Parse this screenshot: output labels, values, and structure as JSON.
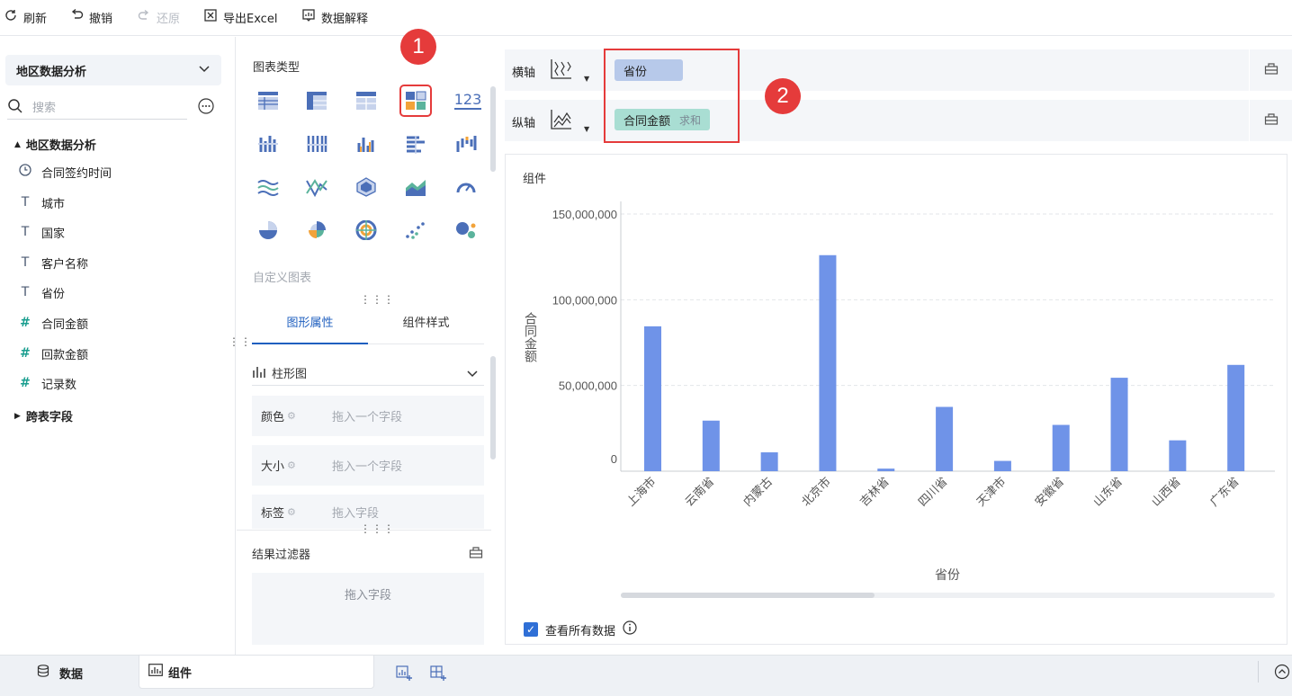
{
  "toolbar": {
    "refresh": "刷新",
    "undo": "撤销",
    "redo": "还原",
    "export": "导出Excel",
    "explain": "数据解释"
  },
  "left": {
    "dataset": "地区数据分析",
    "search_placeholder": "搜索",
    "tree_root": "地区数据分析",
    "fields": [
      {
        "label": "合同签约时间",
        "icon": "clock-icon"
      },
      {
        "label": "城市",
        "icon": "text-field-icon"
      },
      {
        "label": "国家",
        "icon": "text-field-icon"
      },
      {
        "label": "客户名称",
        "icon": "text-field-icon"
      },
      {
        "label": "省份",
        "icon": "text-field-icon"
      },
      {
        "label": "合同金额",
        "icon": "number-field-icon"
      },
      {
        "label": "回款金额",
        "icon": "number-field-icon"
      },
      {
        "label": "记录数",
        "icon": "number-field-icon"
      }
    ],
    "cross_table": "跨表字段"
  },
  "middle": {
    "chart_types_title": "图表类型",
    "custom_chart": "自定义图表",
    "tabs": [
      "图形属性",
      "组件样式"
    ],
    "mark_type": "柱形图",
    "props": [
      {
        "label": "颜色",
        "placeholder": "拖入一个字段"
      },
      {
        "label": "大小",
        "placeholder": "拖入一个字段"
      },
      {
        "label": "标签",
        "placeholder": "拖入字段"
      }
    ],
    "filter_title": "结果过滤器",
    "filter_placeholder": "拖入字段",
    "number_icon_text": "123"
  },
  "axes": {
    "x_label": "横轴",
    "y_label": "纵轴",
    "x_field": "省份",
    "y_field": "合同金额",
    "y_agg": "求和"
  },
  "callouts": [
    "1",
    "2"
  ],
  "chart_title": "组件",
  "chart_data": {
    "type": "bar",
    "categories": [
      "上海市",
      "云南省",
      "内蒙古",
      "北京市",
      "吉林省",
      "四川省",
      "天津市",
      "安徽省",
      "山东省",
      "山西省",
      "广东省"
    ],
    "values": [
      84500000,
      29500000,
      11000000,
      126000000,
      1500000,
      37500000,
      6000000,
      27000000,
      54500000,
      18000000,
      62000000
    ],
    "xlabel": "省份",
    "ylabel": "合同金额",
    "ylim": [
      0,
      150000000
    ],
    "yticks": [
      "0",
      "50,000,000",
      "100,000,000",
      "150,000,000"
    ],
    "bar_color": "#6f93e8",
    "grid": true
  },
  "view_all": "查看所有数据",
  "bottom": {
    "data_tab": "数据",
    "component_tab": "组件"
  }
}
